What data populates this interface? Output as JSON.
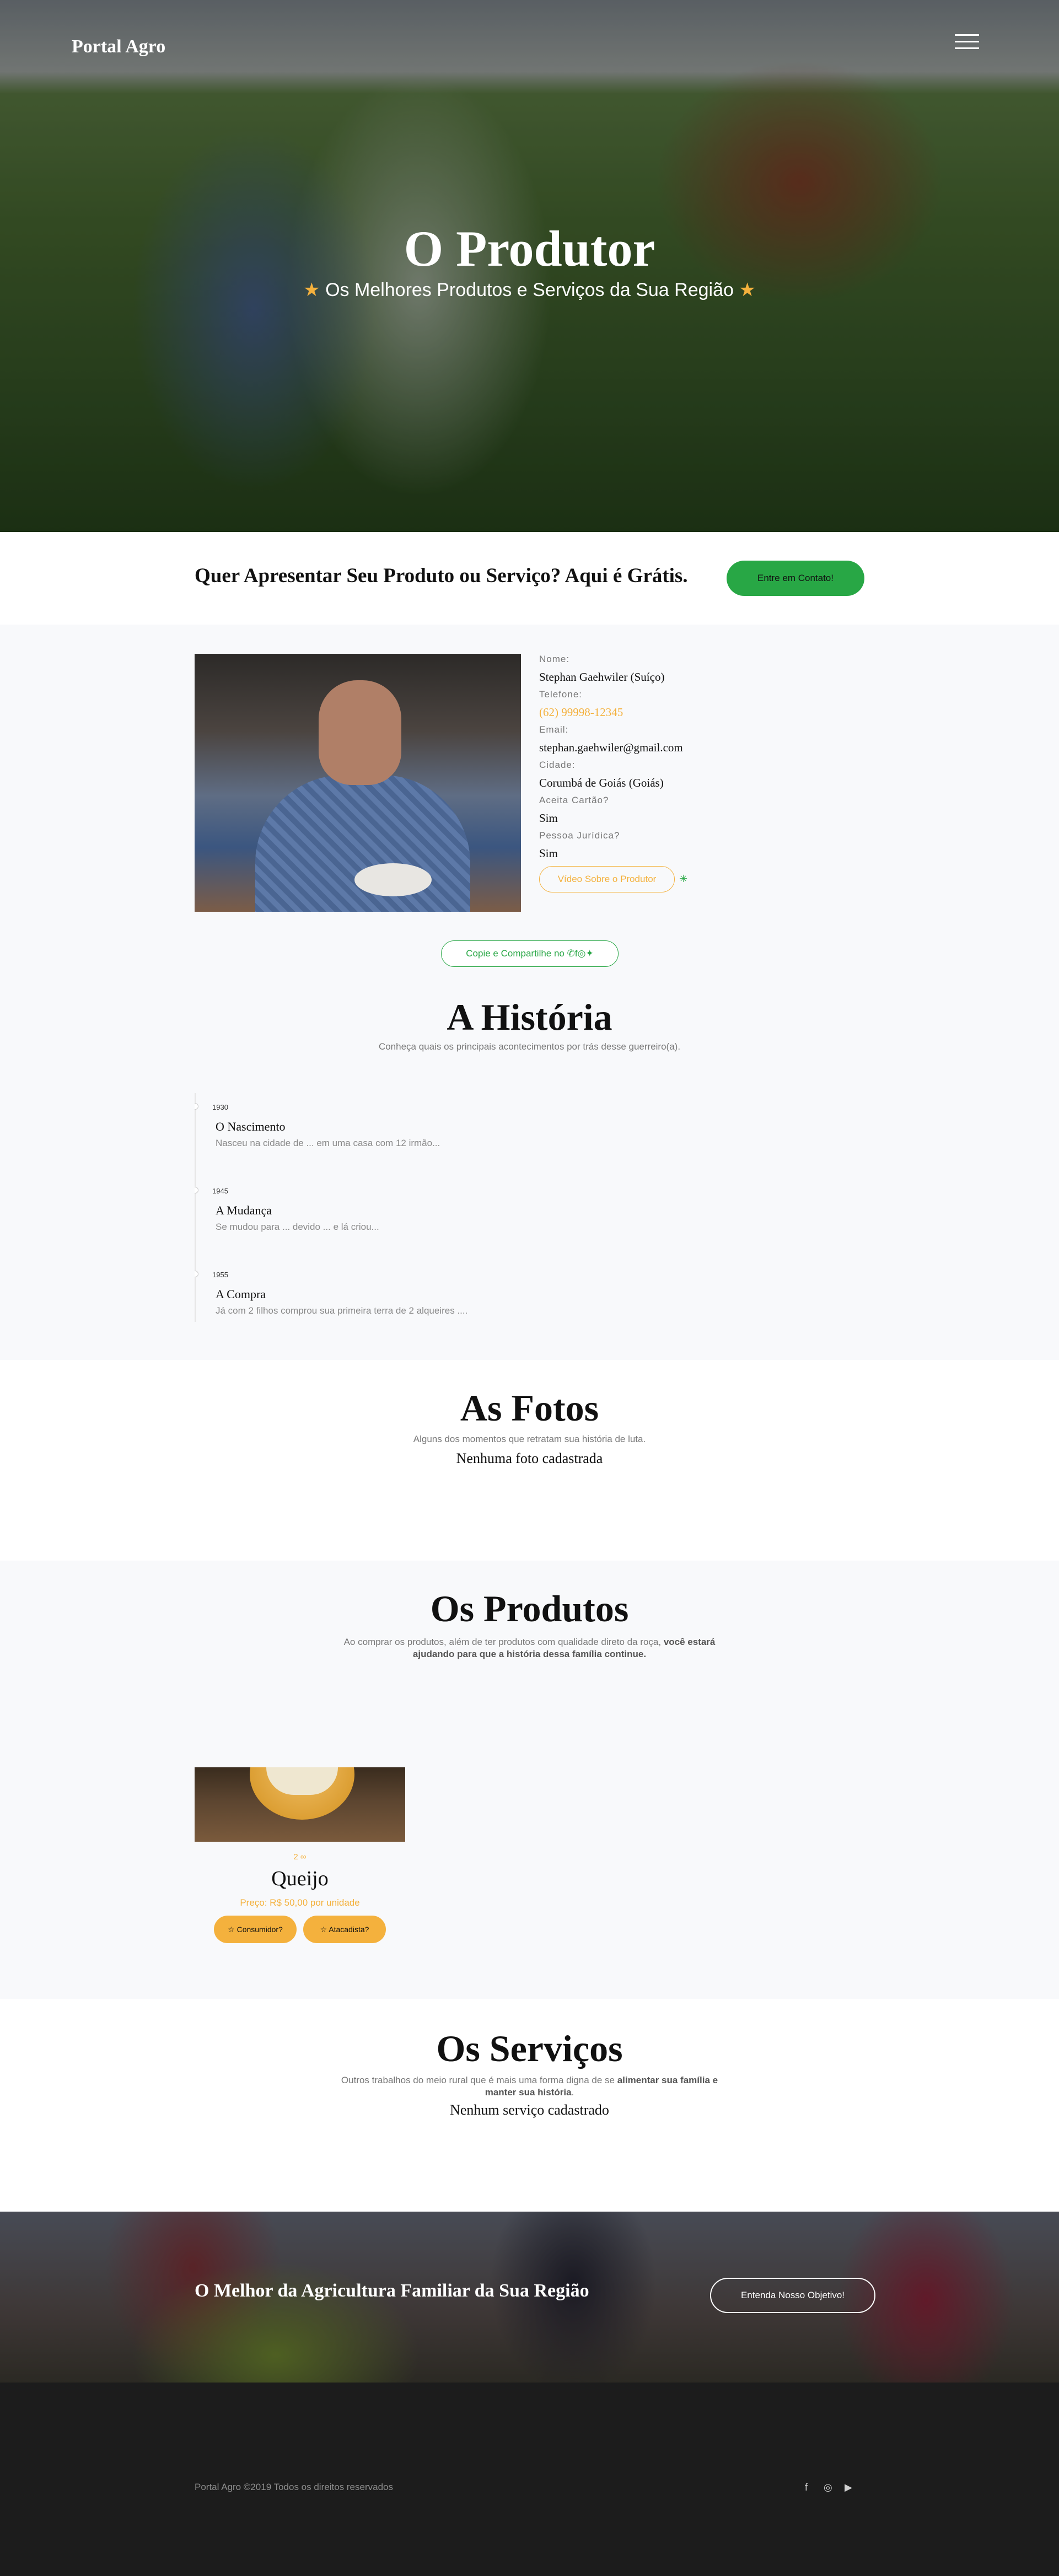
{
  "header": {
    "brand": "Portal Agro",
    "menu_icon": "hamburger-icon"
  },
  "hero": {
    "title": "O Produtor",
    "subtitle": "Os Melhores Produtos e Serviços da Sua Região",
    "star_icon": "star-icon"
  },
  "cta": {
    "text": "Quer Apresentar Seu Produto ou Serviço? Aqui é Grátis.",
    "button": "Entre em Contato!"
  },
  "producer": {
    "fields": [
      {
        "label": "Nome:",
        "value": "Stephan Gaehwiler (Suíço)"
      },
      {
        "label": "Telefone:",
        "value": "(62) 99998-12345"
      },
      {
        "label": "Email:",
        "value": "stephan.gaehwiler@gmail.com"
      },
      {
        "label": "Cidade:",
        "value": "Corumbá de Goiás (Goiás)"
      },
      {
        "label": "Aceita Cartão?",
        "value": "Sim"
      },
      {
        "label": "Pessoa Jurídica?",
        "value": "Sim"
      }
    ],
    "video_button": "Vídeo Sobre o Produtor",
    "share_button": "Copie e Compartilhe no"
  },
  "history": {
    "title": "A História",
    "subtitle": "Conheça quais os principais acontecimentos por trás desse guerreiro(a).",
    "events": [
      {
        "year": "1930",
        "title": "O Nascimento",
        "text": "Nasceu na cidade de ... em uma casa com 12 irmão..."
      },
      {
        "year": "1945",
        "title": "A Mudança",
        "text": "Se mudou para ... devido ... e lá criou..."
      },
      {
        "year": "1955",
        "title": "A Compra",
        "text": "Já com 2 filhos comprou sua primeira terra de 2 alqueires ...."
      }
    ]
  },
  "photos": {
    "title": "As Fotos",
    "subtitle": "Alguns dos momentos que retratam sua história de luta.",
    "empty": "Nenhuma foto cadastrada"
  },
  "products": {
    "title": "Os Produtos",
    "subtitle_start": "Ao comprar os produtos, além de ter produtos com qualidade direto da roça, ",
    "subtitle_bold": "você estará ajudando para que a história dessa família continue.",
    "items": [
      {
        "qty": "2 ∞",
        "name": "Queijo",
        "price": "Preço: R$ 50,00 por unidade",
        "btn_consumer": "☆ Consumidor?",
        "btn_wholesale": "☆ Atacadista?"
      }
    ]
  },
  "services": {
    "title": "Os Serviços",
    "subtitle_start": "Outros trabalhos do meio rural que é mais uma forma digna de se ",
    "subtitle_bold": "alimentar sua família e manter sua história",
    "subtitle_end": ".",
    "empty": "Nenhum serviço cadastrado"
  },
  "banner": {
    "text": "O Melhor da Agricultura Familiar da Sua Região",
    "button": "Entenda Nosso Objetivo!"
  },
  "footer": {
    "copyright": "Portal Agro ©2019 Todos os direitos reservados",
    "social": [
      "facebook-icon",
      "instagram-icon",
      "youtube-icon"
    ]
  },
  "colors": {
    "accent_green": "#28a745",
    "accent_orange": "#f4b13d",
    "footer_bg": "#1c1c1c"
  }
}
